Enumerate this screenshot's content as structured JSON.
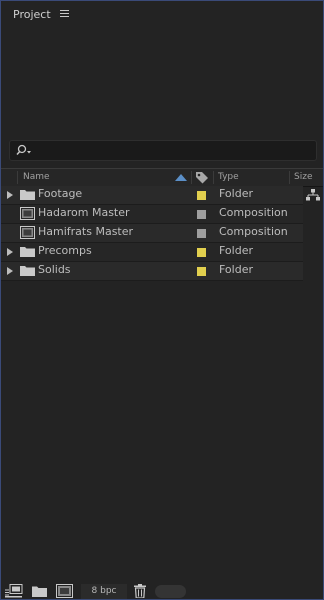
{
  "panel": {
    "title": "Project"
  },
  "search": {
    "value": "",
    "placeholder": ""
  },
  "columns": {
    "name": "Name",
    "type": "Type",
    "size": "Size"
  },
  "items": [
    {
      "name": "Footage",
      "type": "Folder",
      "kind": "folder",
      "label_color": "#e1cf4e"
    },
    {
      "name": "Hadarom Master",
      "type": "Composition",
      "kind": "composition",
      "label_color": "#9e9e9e"
    },
    {
      "name": "Hamifrats Master",
      "type": "Composition",
      "kind": "composition",
      "label_color": "#9e9e9e"
    },
    {
      "name": "Precomps",
      "type": "Folder",
      "kind": "folder",
      "label_color": "#e1cf4e"
    },
    {
      "name": "Solids",
      "type": "Folder",
      "kind": "folder",
      "label_color": "#e1cf4e"
    }
  ],
  "footer": {
    "bpc_label": "8 bpc"
  },
  "colors": {
    "panel_border": "#3a4a78",
    "background": "#232323",
    "accent": "#5b8fc7"
  },
  "icons": [
    "hamburger-menu-icon",
    "search-icon",
    "sort-ascending-icon",
    "label-tag-icon",
    "flowchart-icon",
    "folder-icon",
    "composition-icon",
    "interpret-footage-icon",
    "new-folder-icon",
    "new-composition-icon",
    "trash-icon"
  ]
}
